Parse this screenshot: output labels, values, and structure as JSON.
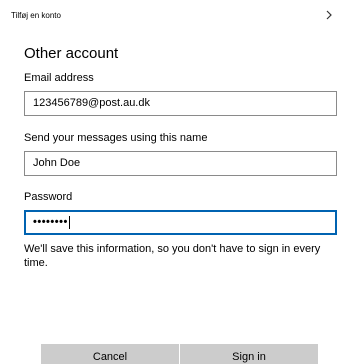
{
  "window": {
    "title": "Tilføj en konto",
    "nav_icon": "chevron-right-icon"
  },
  "form": {
    "heading": "Other account",
    "email": {
      "label": "Email address",
      "value": "123456789@post.au.dk"
    },
    "display_name": {
      "label": "Send your messages using this name",
      "value": "John Doe"
    },
    "password": {
      "label": "Password",
      "masked_value": "••••••••"
    },
    "info_text": "We'll save this information, so you don't have to sign in every time."
  },
  "buttons": {
    "cancel_label": "Cancel",
    "signin_label": "Sign in"
  },
  "colors": {
    "focus_border": "#0063b1",
    "field_border": "#8a8a8a",
    "button_bg": "#cccccc"
  }
}
